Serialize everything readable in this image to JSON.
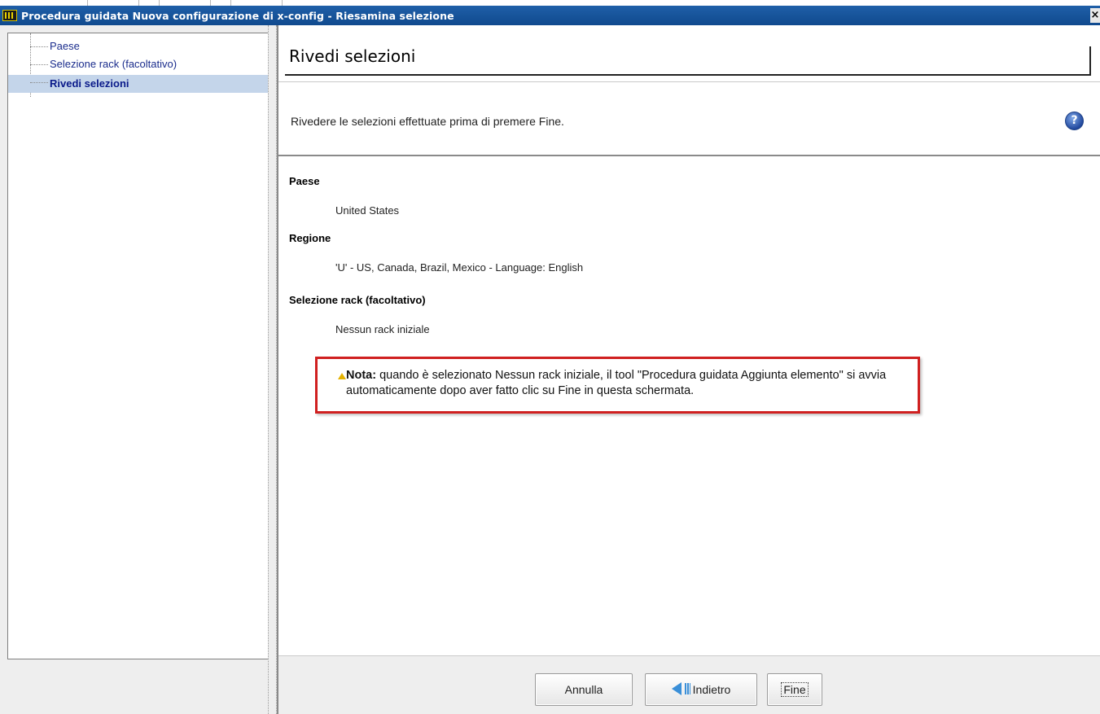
{
  "window": {
    "title": "Procedura guidata Nuova configurazione di x-config - Riesamina selezione",
    "close_glyph": "×"
  },
  "steps": [
    {
      "label": "Paese",
      "active": false
    },
    {
      "label": "Selezione rack (facoltativo)",
      "active": false
    },
    {
      "label": "Rivedi selezioni",
      "active": true
    }
  ],
  "page": {
    "title": "Rivedi selezioni",
    "description": "Rivedere le selezioni effettuate prima di premere Fine.",
    "help_icon": "help-question-icon"
  },
  "summary": {
    "country_label": "Paese",
    "country_value": "United States",
    "region_label": "Regione",
    "region_value": "'U' - US, Canada, Brazil, Mexico - Language: English",
    "rack_label": "Selezione rack (facoltativo)",
    "rack_value": "Nessun rack iniziale"
  },
  "note": {
    "icon": "warning-triangle-icon",
    "prefix": "Nota:",
    "text": " quando è selezionato Nessun rack iniziale, il tool \"Procedura guidata Aggiunta elemento\" si avvia automaticamente dopo aver fatto clic su Fine in questa schermata."
  },
  "buttons": {
    "cancel": "Annulla",
    "back": "Indietro",
    "finish": "Fine"
  },
  "colors": {
    "titlebar": "#1f5fa8",
    "active_step_bg": "#c4d5ea",
    "note_border": "#d02020"
  }
}
